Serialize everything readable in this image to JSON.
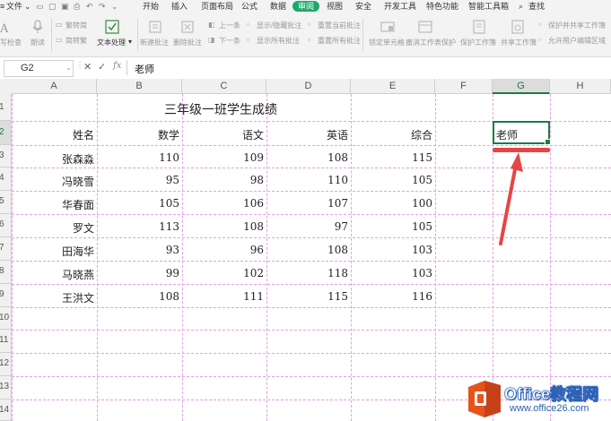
{
  "menu": {
    "file": "文件",
    "tabs": [
      "开始",
      "插入",
      "页面布局",
      "公式",
      "数据",
      "审阅",
      "视图",
      "安全",
      "开发工具",
      "特色功能",
      "智能工具箱"
    ],
    "active_tab": "审阅",
    "search": "查找"
  },
  "ribbon": {
    "spell": "写检查",
    "read": "朗读",
    "simp_trad_1": "繁转简",
    "simp_trad_2": "简转繁",
    "text_proc": "文本处理",
    "new_comment": "新建批注",
    "delete_comment": "删除批注",
    "prev": "上一条",
    "next": "下一条",
    "show_hide_comment": "显示/隐藏批注",
    "show_all_comments": "显示所有批注",
    "reset_current_comment": "重置当前批注",
    "reset_all_comments": "重置所有批注",
    "lock_cell": "锁定单元格",
    "unprotect_sheet": "撤消工作表保护",
    "protect_workbook": "保护工作簿",
    "share_workbook": "共享工作簿",
    "protect_share_workbook": "保护并共享工作簿",
    "allow_edit_ranges": "允许用户编辑区域"
  },
  "formula_bar": {
    "cell_ref": "G2",
    "cancel": "✕",
    "confirm": "✓",
    "fx": "fx",
    "value": "老师"
  },
  "columns": [
    "A",
    "B",
    "C",
    "D",
    "E",
    "F",
    "G",
    "H"
  ],
  "selected_column": "G",
  "rows": [
    "1",
    "2",
    "3",
    "4",
    "5",
    "6",
    "7",
    "8",
    "9",
    "10",
    "11",
    "12",
    "13",
    "14"
  ],
  "selected_row": "2",
  "sheet": {
    "title": "三年级一班学生成绩",
    "headers": [
      "姓名",
      "数学",
      "语文",
      "英语",
      "综合"
    ],
    "students": [
      {
        "name": "张森淼",
        "math": "110",
        "chinese": "109",
        "english": "108",
        "total": "115"
      },
      {
        "name": "冯晓雪",
        "math": "95",
        "chinese": "98",
        "english": "110",
        "total": "105"
      },
      {
        "name": "华春面",
        "math": "105",
        "chinese": "106",
        "english": "107",
        "total": "100"
      },
      {
        "name": "罗文",
        "math": "113",
        "chinese": "108",
        "english": "97",
        "total": "105"
      },
      {
        "name": "田海华",
        "math": "93",
        "chinese": "96",
        "english": "108",
        "total": "103"
      },
      {
        "name": "马晓燕",
        "math": "99",
        "chinese": "102",
        "english": "118",
        "total": "103"
      },
      {
        "name": "王洪文",
        "math": "108",
        "chinese": "111",
        "english": "115",
        "total": "116"
      }
    ],
    "g2_value": "老师"
  },
  "watermark": {
    "brand": "Office教程网",
    "url": "www.office26.com"
  },
  "colors": {
    "accent_green": "#1d7a45",
    "active_tab_bg": "#1aa86b",
    "annotation_red": "#e64545",
    "page_break": "#e6a0e6",
    "logo_orange": "#e8531c"
  }
}
